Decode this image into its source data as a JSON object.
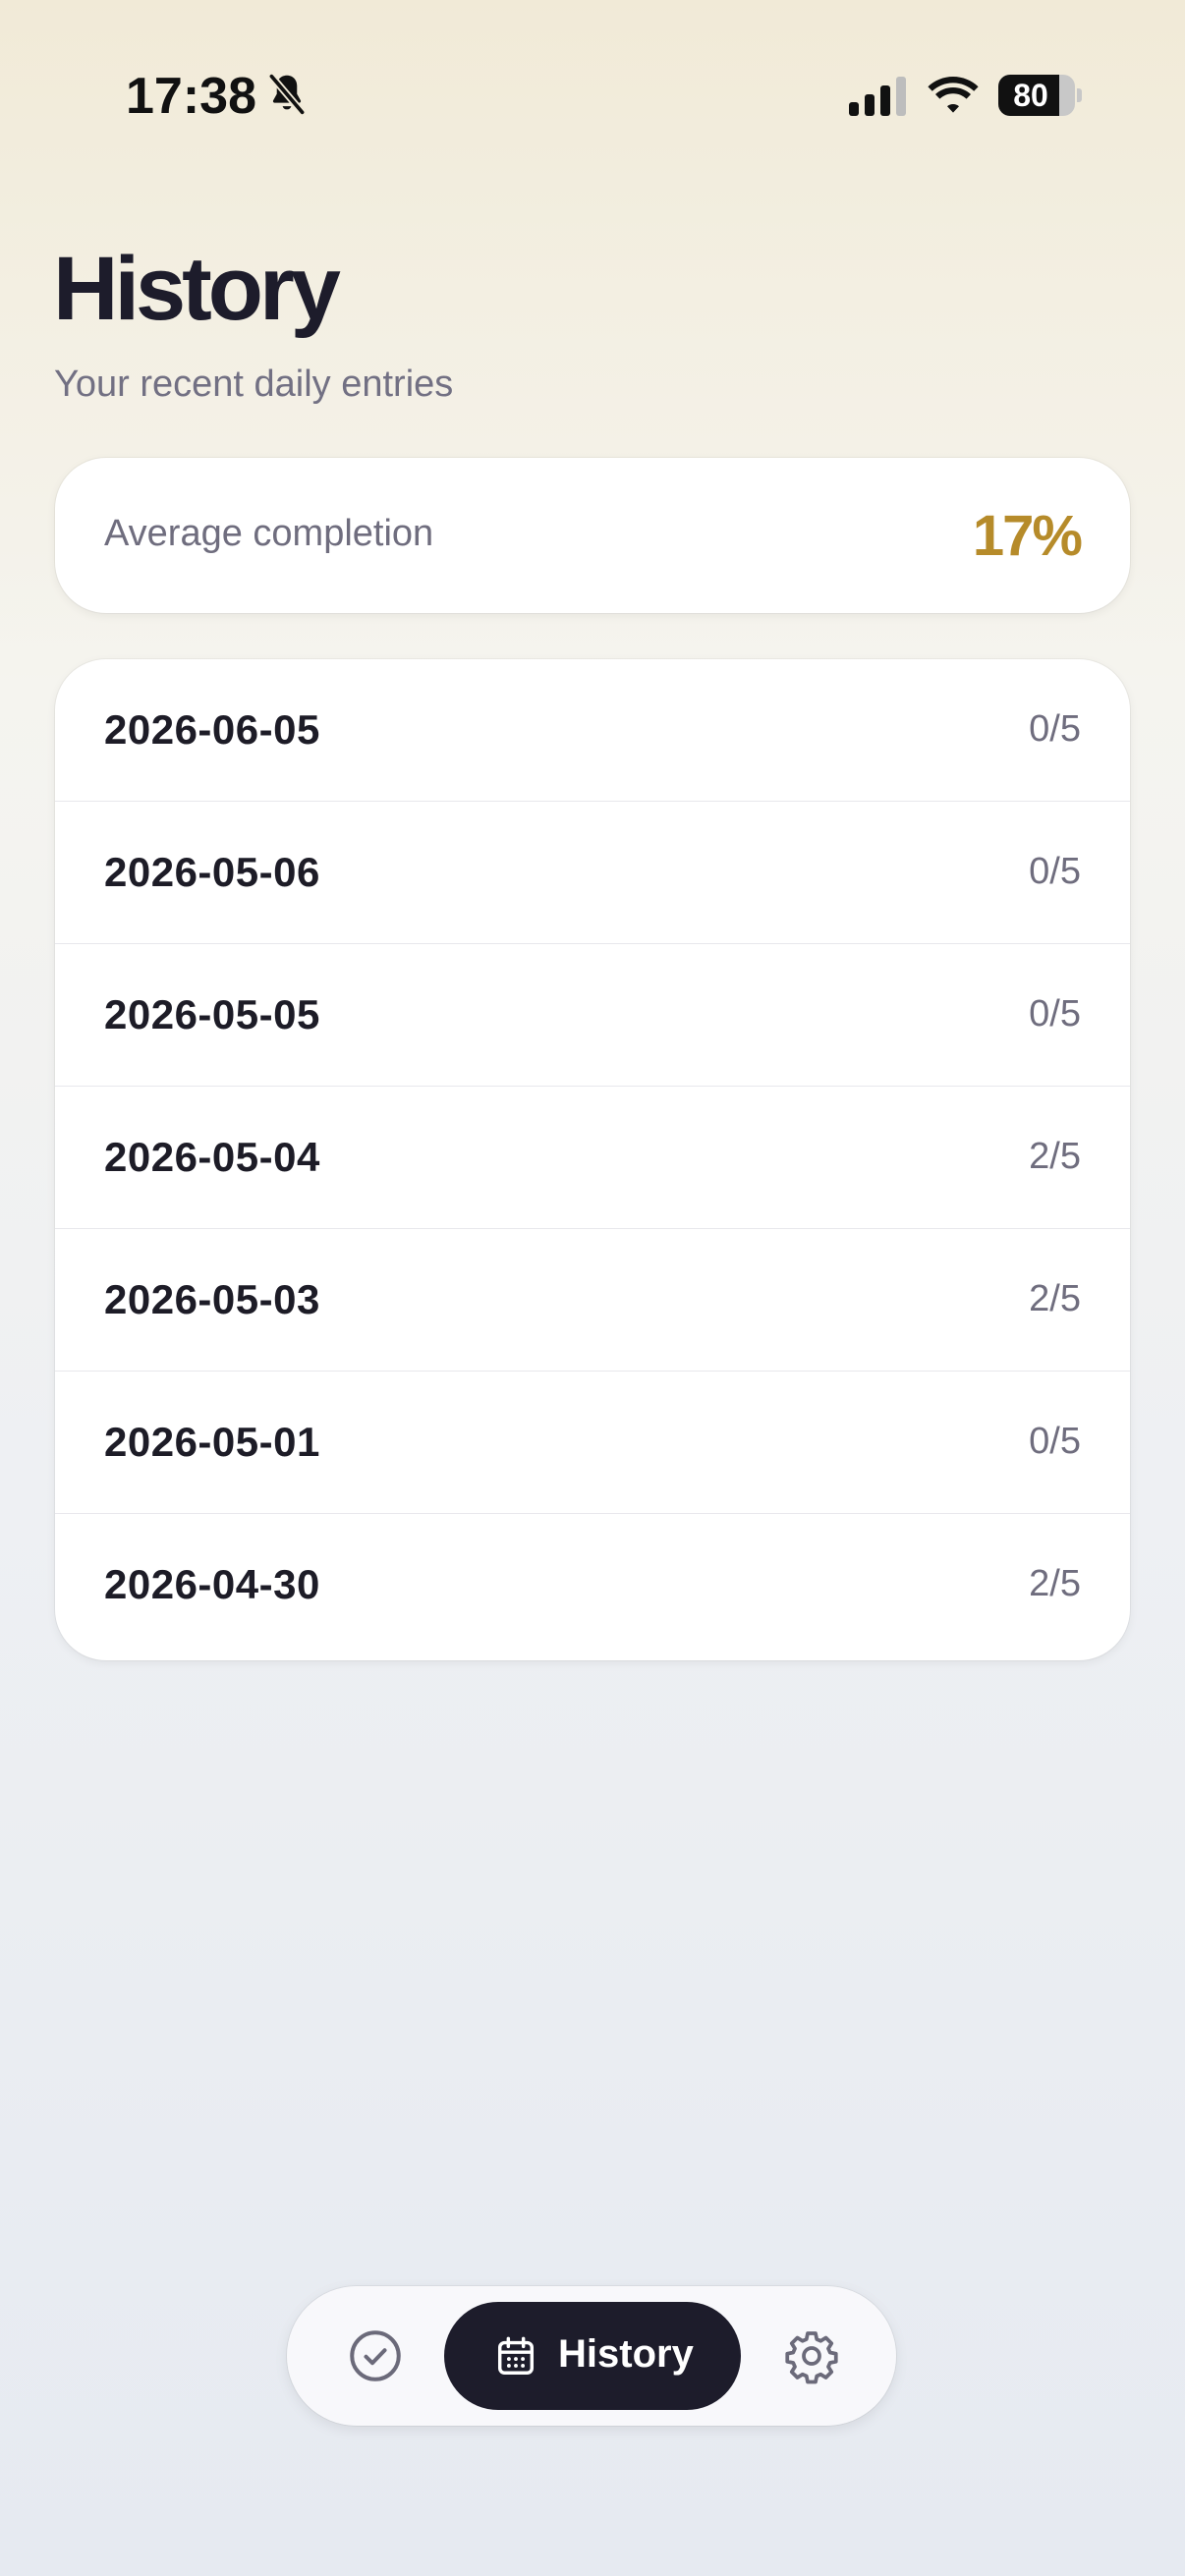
{
  "status_bar": {
    "time": "17:38",
    "battery_level": "80",
    "battery_fraction": 0.8,
    "icons": [
      "bell-slash-icon",
      "signal-icon",
      "wifi-icon",
      "battery-icon"
    ]
  },
  "header": {
    "title": "History",
    "subtitle": "Your recent daily entries"
  },
  "summary": {
    "label": "Average completion",
    "value": "17%",
    "accent_color": "#b68b2a"
  },
  "entries": [
    {
      "date": "2026-06-05",
      "score": "0/5"
    },
    {
      "date": "2026-05-06",
      "score": "0/5"
    },
    {
      "date": "2026-05-05",
      "score": "0/5"
    },
    {
      "date": "2026-05-04",
      "score": "2/5"
    },
    {
      "date": "2026-05-03",
      "score": "2/5"
    },
    {
      "date": "2026-05-01",
      "score": "0/5"
    },
    {
      "date": "2026-04-30",
      "score": "2/5"
    }
  ],
  "tab_bar": {
    "active_tab": "History",
    "tabs": [
      {
        "id": "today",
        "icon": "check-circle-icon"
      },
      {
        "id": "history",
        "icon": "calendar-icon",
        "label": "History"
      },
      {
        "id": "settings",
        "icon": "gear-icon"
      }
    ],
    "active_color": "#1d1c2b"
  }
}
